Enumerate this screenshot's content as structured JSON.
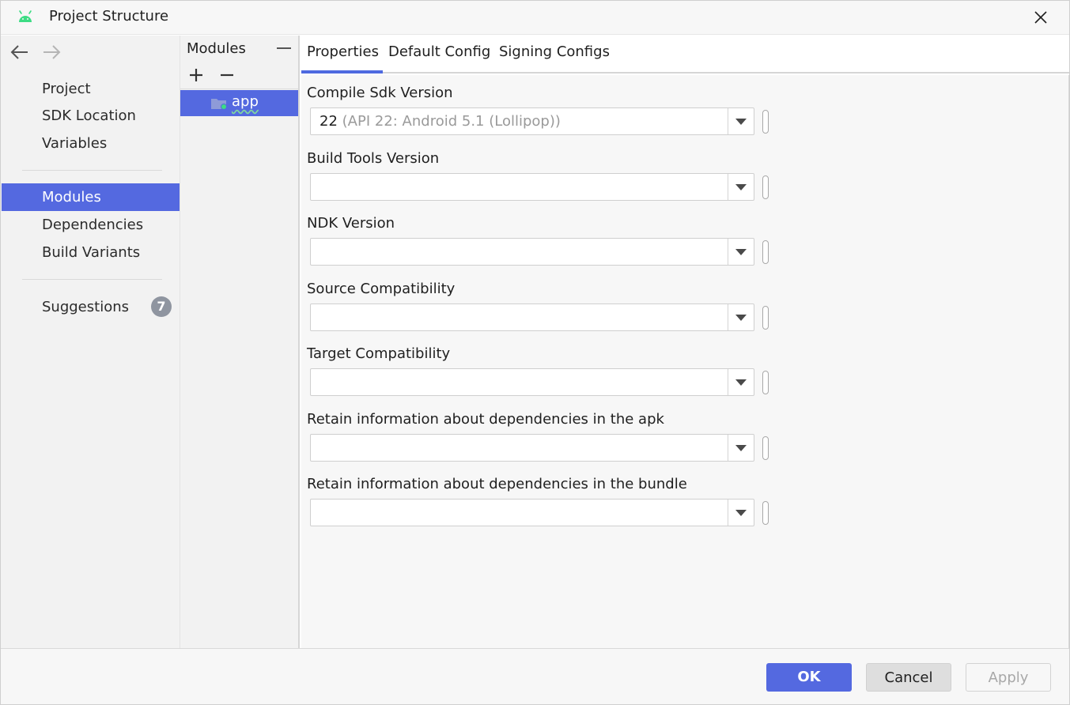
{
  "window": {
    "title": "Project Structure",
    "app_icon": "android-icon",
    "accent_color": "#5469e0"
  },
  "sidebar": {
    "nav_back_icon": "arrow-left-icon",
    "nav_forward_icon": "arrow-right-icon",
    "items": [
      {
        "label": "Project"
      },
      {
        "label": "SDK Location"
      },
      {
        "label": "Variables"
      },
      {
        "label": "Modules",
        "selected": true
      },
      {
        "label": "Dependencies"
      },
      {
        "label": "Build Variants"
      },
      {
        "label": "Suggestions",
        "badge": "7"
      }
    ]
  },
  "modules": {
    "header": "Modules",
    "items": [
      {
        "label": "app",
        "icon": "module-folder-icon"
      }
    ]
  },
  "tabs": [
    {
      "label": "Properties",
      "active": true
    },
    {
      "label": "Default Config"
    },
    {
      "label": "Signing Configs"
    }
  ],
  "fields": [
    {
      "label": "Compile Sdk Version",
      "value": "22",
      "hint": "(API 22: Android 5.1 (Lollipop))"
    },
    {
      "label": "Build Tools Version",
      "value": "",
      "hint": ""
    },
    {
      "label": "NDK Version",
      "value": "",
      "hint": ""
    },
    {
      "label": "Source Compatibility",
      "value": "",
      "hint": ""
    },
    {
      "label": "Target Compatibility",
      "value": "",
      "hint": ""
    },
    {
      "label": "Retain information about dependencies in the apk",
      "value": "",
      "hint": ""
    },
    {
      "label": "Retain information about dependencies in the bundle",
      "value": "",
      "hint": ""
    }
  ],
  "buttons": {
    "ok": "OK",
    "cancel": "Cancel",
    "apply": "Apply"
  }
}
